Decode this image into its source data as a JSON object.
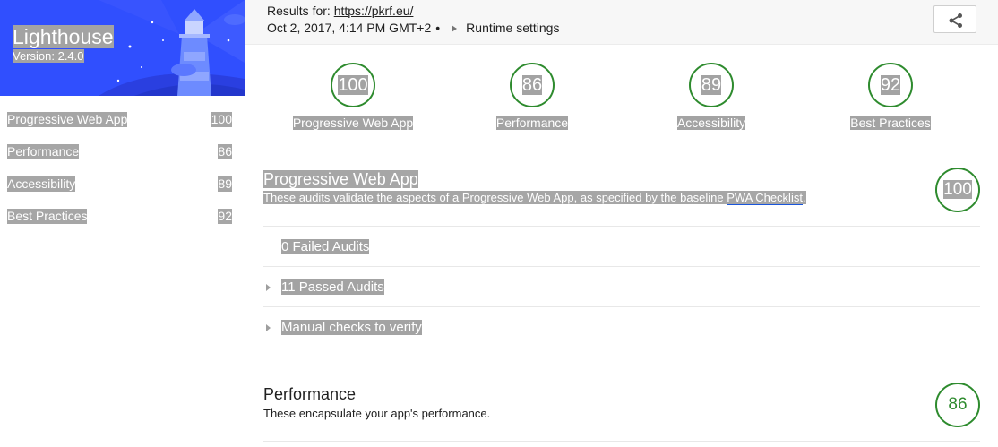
{
  "app": {
    "title": "Lighthouse",
    "version": "Version: 2.4.0"
  },
  "sidebar": {
    "items": [
      {
        "label": "Progressive Web App",
        "score": "100"
      },
      {
        "label": "Performance",
        "score": "86"
      },
      {
        "label": "Accessibility",
        "score": "89"
      },
      {
        "label": "Best Practices",
        "score": "92"
      }
    ]
  },
  "header": {
    "results_prefix": "Results for: ",
    "url": "https://pkrf.eu/",
    "date": "Oct 2, 2017, 4:14 PM GMT+2",
    "separator": "•",
    "runtime_settings": "Runtime settings",
    "share_icon": "share-icon"
  },
  "scores": [
    {
      "label": "Progressive Web App",
      "score": "100"
    },
    {
      "label": "Performance",
      "score": "86"
    },
    {
      "label": "Accessibility",
      "score": "89"
    },
    {
      "label": "Best Practices",
      "score": "92"
    }
  ],
  "pwa_section": {
    "title": "Progressive Web App",
    "description": "These audits validate the aspects of a Progressive Web App, as specified by the baseline ",
    "link": "PWA Checklist",
    "link_suffix": ".",
    "score": "100",
    "groups": [
      {
        "label": "0 Failed Audits"
      },
      {
        "label": "11 Passed Audits"
      },
      {
        "label": "Manual checks to verify"
      }
    ]
  },
  "performance_section": {
    "title": "Performance",
    "description": "These encapsulate your app's performance.",
    "score": "86"
  },
  "colors": {
    "brand_blue": "#304ffe",
    "pass_green": "#2e8b2e",
    "selection_gray": "#a3a3a3"
  }
}
